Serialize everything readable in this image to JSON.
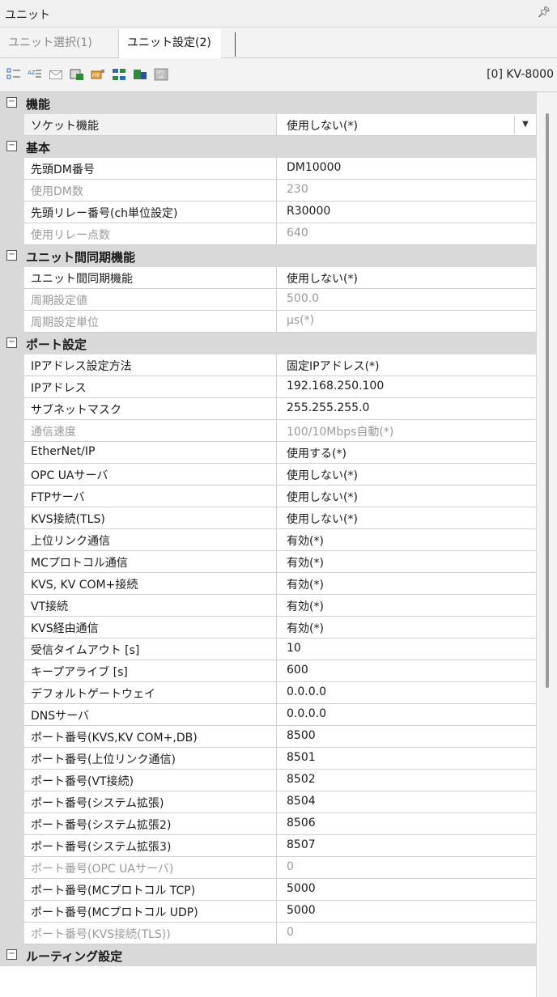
{
  "window": {
    "title": "ユニット",
    "pin_icon": "pin-icon"
  },
  "tabs": [
    {
      "label": "ユニット選択(1)",
      "active": false
    },
    {
      "label": "ユニット設定(2)",
      "active": true
    }
  ],
  "toolbar": {
    "icons": [
      "sort-categorized-icon",
      "sort-alphabetical-icon",
      "message-icon",
      "save-unit-icon",
      "ftp-icon",
      "network-icon",
      "transfer-icon",
      "opc-ua-icon"
    ],
    "device_label": "[0] KV-8000"
  },
  "categories": [
    {
      "label": "機能",
      "items": [
        {
          "name": "ソケット機能",
          "value": "使用しない(*)",
          "disabled": false,
          "dropdown": true
        }
      ]
    },
    {
      "label": "基本",
      "items": [
        {
          "name": "先頭DM番号",
          "value": "DM10000",
          "disabled": false
        },
        {
          "name": "使用DM数",
          "value": "230",
          "disabled": true
        },
        {
          "name": "先頭リレー番号(ch単位設定)",
          "value": "R30000",
          "disabled": false
        },
        {
          "name": "使用リレー点数",
          "value": "640",
          "disabled": true
        }
      ]
    },
    {
      "label": "ユニット間同期機能",
      "items": [
        {
          "name": "ユニット間同期機能",
          "value": "使用しない(*)",
          "disabled": false
        },
        {
          "name": "周期設定値",
          "value": "500.0",
          "disabled": true
        },
        {
          "name": "周期設定単位",
          "value": "μs(*)",
          "disabled": true
        }
      ]
    },
    {
      "label": "ポート設定",
      "items": [
        {
          "name": "IPアドレス設定方法",
          "value": "固定IPアドレス(*)",
          "disabled": false
        },
        {
          "name": "IPアドレス",
          "value": "192.168.250.100",
          "disabled": false
        },
        {
          "name": "サブネットマスク",
          "value": "255.255.255.0",
          "disabled": false
        },
        {
          "name": "通信速度",
          "value": "100/10Mbps自動(*)",
          "disabled": true
        },
        {
          "name": "EtherNet/IP",
          "value": "使用する(*)",
          "disabled": false
        },
        {
          "name": "OPC UAサーバ",
          "value": "使用しない(*)",
          "disabled": false
        },
        {
          "name": "FTPサーバ",
          "value": "使用しない(*)",
          "disabled": false
        },
        {
          "name": "KVS接続(TLS)",
          "value": "使用しない(*)",
          "disabled": false
        },
        {
          "name": "上位リンク通信",
          "value": "有効(*)",
          "disabled": false
        },
        {
          "name": "MCプロトコル通信",
          "value": "有効(*)",
          "disabled": false
        },
        {
          "name": "KVS, KV COM+接続",
          "value": "有効(*)",
          "disabled": false
        },
        {
          "name": "VT接続",
          "value": "有効(*)",
          "disabled": false
        },
        {
          "name": "KVS経由通信",
          "value": "有効(*)",
          "disabled": false
        },
        {
          "name": "受信タイムアウト [s]",
          "value": "10",
          "disabled": false
        },
        {
          "name": "キープアライブ [s]",
          "value": "600",
          "disabled": false
        },
        {
          "name": "デフォルトゲートウェイ",
          "value": "0.0.0.0",
          "disabled": false
        },
        {
          "name": "DNSサーバ",
          "value": "0.0.0.0",
          "disabled": false
        },
        {
          "name": "ポート番号(KVS,KV COM+,DB)",
          "value": "8500",
          "disabled": false
        },
        {
          "name": "ポート番号(上位リンク通信)",
          "value": "8501",
          "disabled": false
        },
        {
          "name": "ポート番号(VT接続)",
          "value": "8502",
          "disabled": false
        },
        {
          "name": "ポート番号(システム拡張)",
          "value": "8504",
          "disabled": false
        },
        {
          "name": "ポート番号(システム拡張2)",
          "value": "8506",
          "disabled": false
        },
        {
          "name": "ポート番号(システム拡張3)",
          "value": "8507",
          "disabled": false
        },
        {
          "name": "ポート番号(OPC UAサーバ)",
          "value": "0",
          "disabled": true
        },
        {
          "name": "ポート番号(MCプロトコル TCP)",
          "value": "5000",
          "disabled": false
        },
        {
          "name": "ポート番号(MCプロトコル UDP)",
          "value": "5000",
          "disabled": false
        },
        {
          "name": "ポート番号(KVS接続(TLS))",
          "value": "0",
          "disabled": true
        }
      ]
    },
    {
      "label": "ルーティング設定",
      "items": []
    }
  ]
}
